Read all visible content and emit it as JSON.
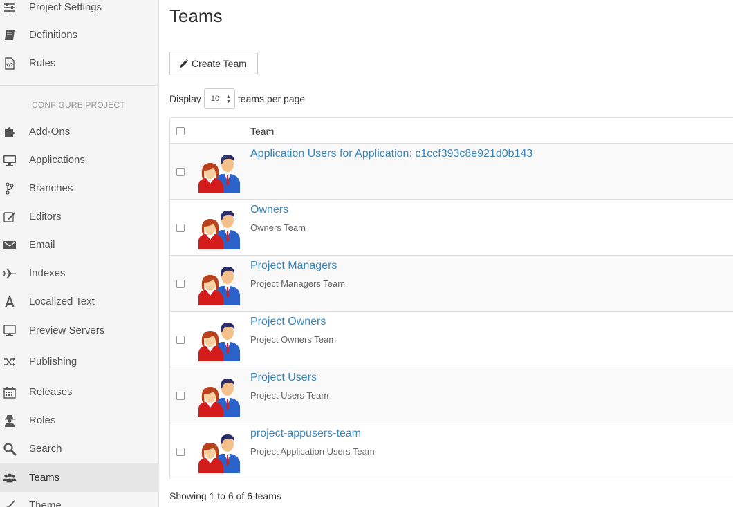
{
  "sidebar": {
    "top_items": [
      {
        "label": "Project Settings",
        "icon": "sliders-icon"
      },
      {
        "label": "Definitions",
        "icon": "book-icon"
      },
      {
        "label": "Rules",
        "icon": "code-file-icon"
      }
    ],
    "section_header": "CONFIGURE PROJECT",
    "items": [
      {
        "label": "Add-Ons",
        "icon": "puzzle-icon"
      },
      {
        "label": "Applications",
        "icon": "desktop-icon"
      },
      {
        "label": "Branches",
        "icon": "branch-icon"
      },
      {
        "label": "Editors",
        "icon": "edit-icon"
      },
      {
        "label": "Email",
        "icon": "envelope-icon"
      },
      {
        "label": "Indexes",
        "icon": "plane-icon"
      },
      {
        "label": "Localized Text",
        "icon": "font-icon"
      },
      {
        "label": "Preview Servers",
        "icon": "monitor-icon"
      },
      {
        "label": "Publishing",
        "icon": "shuffle-icon"
      },
      {
        "label": "Releases",
        "icon": "calendar-icon"
      },
      {
        "label": "Roles",
        "icon": "user-secret-icon"
      },
      {
        "label": "Search",
        "icon": "search-icon"
      },
      {
        "label": "Teams",
        "icon": "users-icon",
        "active": true
      },
      {
        "label": "Theme",
        "icon": "brush-icon"
      }
    ]
  },
  "main": {
    "title": "Teams",
    "create_button": "Create Team",
    "display_label": "Display",
    "per_page_value": "10",
    "per_page_suffix": "teams per page",
    "column_header": "Team",
    "rows": [
      {
        "name": "Application Users for Application: c1ccf393c8e921d0b143",
        "description": ""
      },
      {
        "name": "Owners",
        "description": "Owners Team"
      },
      {
        "name": "Project Managers",
        "description": "Project Managers Team"
      },
      {
        "name": "Project Owners",
        "description": "Project Owners Team"
      },
      {
        "name": "Project Users",
        "description": "Project Users Team"
      },
      {
        "name": "project-appusers-team",
        "description": "Project Application Users Team"
      }
    ],
    "footer": "Showing 1 to 6 of 6 teams"
  },
  "colors": {
    "link": "#3a87c0",
    "sidebar_bg": "#f5f5f5",
    "active_bg": "#e6e6e6"
  }
}
